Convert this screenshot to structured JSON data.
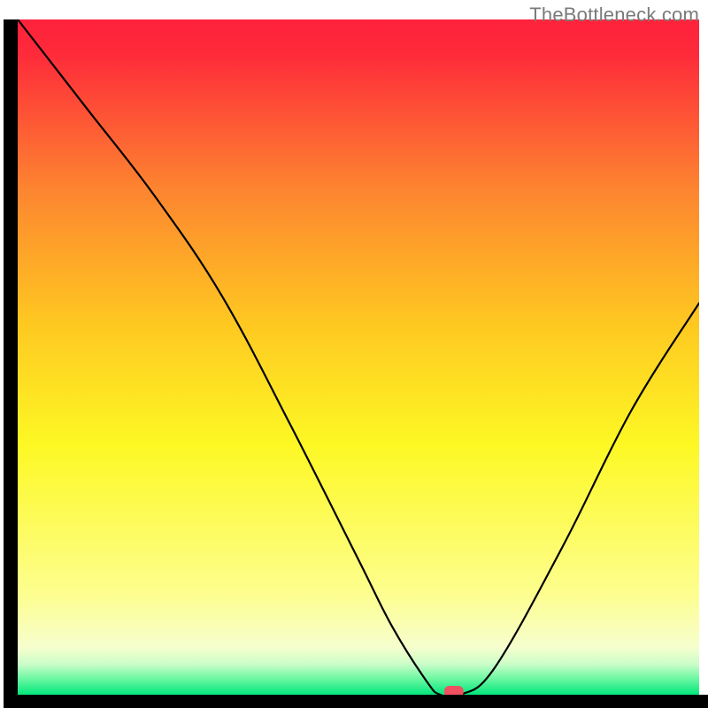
{
  "watermark": "TheBottleneck.com",
  "chart_data": {
    "type": "line",
    "title": "",
    "xlabel": "",
    "ylabel": "",
    "xlim": [
      0,
      100
    ],
    "ylim": [
      0,
      100
    ],
    "legend": false,
    "grid": false,
    "series": [
      {
        "name": "bottleneck-curve",
        "x": [
          0,
          10,
          20,
          30,
          40,
          50,
          55,
          60,
          62,
          65,
          70,
          80,
          90,
          100
        ],
        "y": [
          100,
          87,
          74,
          59,
          40,
          20,
          10,
          2,
          0,
          0,
          4,
          22,
          42,
          58
        ]
      }
    ],
    "marker": {
      "x": 64,
      "y": 0,
      "name": "operating-point"
    },
    "bands": [
      {
        "name": "red",
        "y_from": 100,
        "y_to": 35,
        "y_mid": 90,
        "color": "#fe223b"
      },
      {
        "name": "orange",
        "y_from": 35,
        "y_to": 15,
        "y_mid": 25,
        "color": "#feca20"
      },
      {
        "name": "yellow",
        "y_from": 15,
        "y_to": 5,
        "y_mid": 9,
        "color": "#fdfe9d"
      },
      {
        "name": "pale-green",
        "y_from": 5,
        "y_to": 2,
        "y_mid": 3.5,
        "color": "#b0fcb9"
      },
      {
        "name": "green",
        "y_from": 2,
        "y_to": 0,
        "y_mid": 1,
        "color": "#02e77c"
      }
    ]
  }
}
